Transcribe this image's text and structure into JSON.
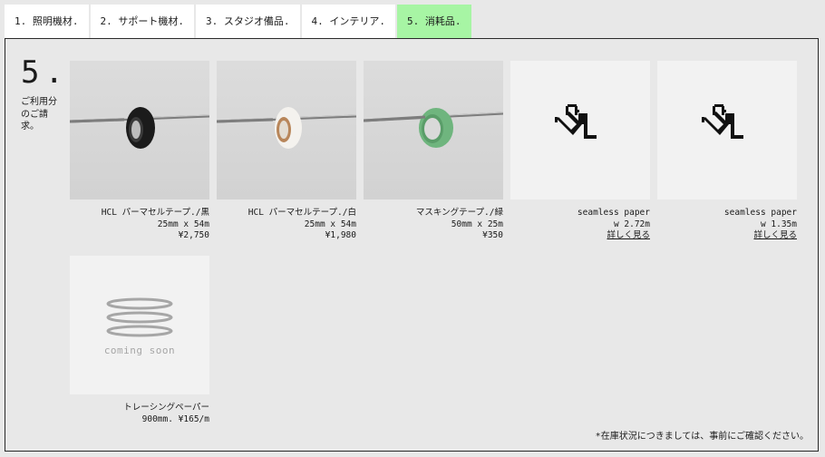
{
  "tabs": [
    {
      "label": "1. 照明機材."
    },
    {
      "label": "2. サポート機材."
    },
    {
      "label": "3. スタジオ備品."
    },
    {
      "label": "4. インテリア."
    },
    {
      "label": "5. 消耗品."
    }
  ],
  "active_tab_index": 4,
  "section": {
    "number": "5.",
    "note": "ご利用分のご請求。"
  },
  "products": [
    {
      "line1": "HCL パーマセルテープ./黒",
      "line2": "25mm x 54m",
      "line3": "¥2,750",
      "image": "tape-black-photo"
    },
    {
      "line1": "HCL パーマセルテープ./白",
      "line2": "25mm x 54m",
      "line3": "¥1,980",
      "image": "tape-white-photo"
    },
    {
      "line1": "マスキングテープ./緑",
      "line2": "50mm x 25m",
      "line3": "¥350",
      "image": "tape-green-photo"
    },
    {
      "line1": "seamless paper",
      "line2": "w 2.72m",
      "link": "詳しく見る",
      "image": "paint-bucket-icon"
    },
    {
      "line1": "seamless paper",
      "line2": "w 1.35m",
      "link": "詳しく見る",
      "image": "paint-bucket-icon"
    },
    {
      "line1": "トレーシングペーパー",
      "line2": "900mm. ¥165/m",
      "image": "coming-soon-icon",
      "image_text": "coming soon"
    }
  ],
  "footnote": "*在庫状況につきましては、事前にご確認ください。",
  "colors": {
    "active_tab": "#a7f5a4",
    "tape_black": "#1b1b1b",
    "tape_white": "#f4f2ee",
    "tape_green": "#6fb57e"
  }
}
